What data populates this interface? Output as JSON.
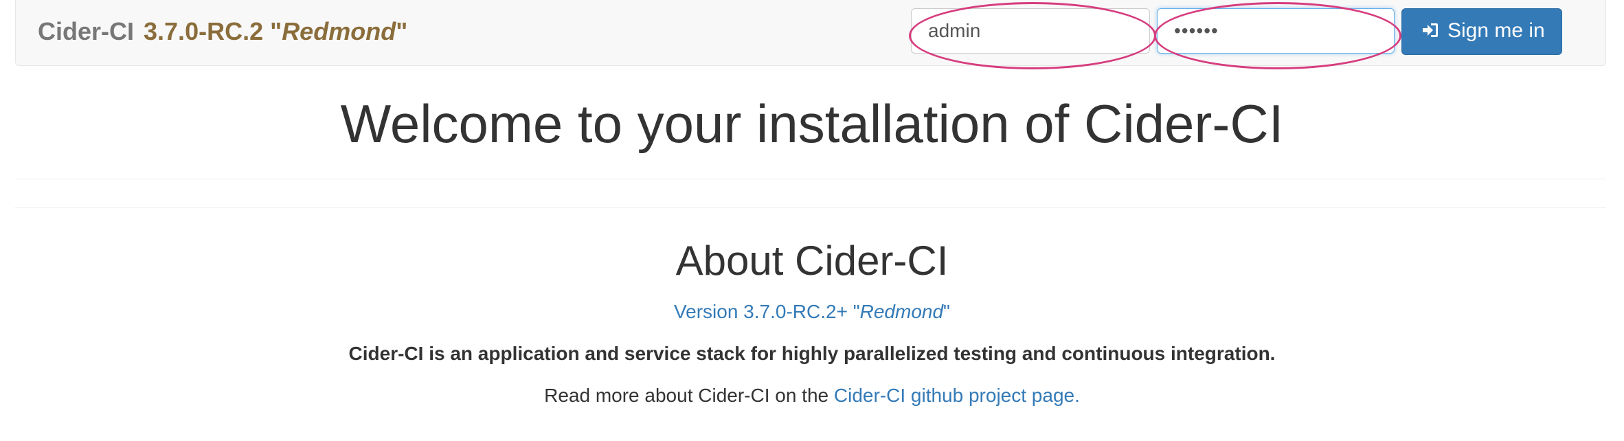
{
  "navbar": {
    "brand_name": "Cider-CI",
    "version_number": "3.7.0-RC.2",
    "quote_open": "\"",
    "codename": "Redmond",
    "quote_close": "\""
  },
  "login": {
    "username_value": "admin",
    "password_value": "••••••",
    "signin_label": "Sign me in",
    "signin_icon": "sign-in-icon"
  },
  "main": {
    "welcome_title": "Welcome to your installation of Cider-CI",
    "about_title": "About Cider-CI",
    "version_prefix": "Version  3.7.0-RC.2+ \"",
    "version_codename": "Redmond",
    "version_suffix": "\"",
    "tagline": "Cider-CI is an application and service stack for highly parallelized testing and continuous integration.",
    "readmore_text": "Read more about Cider-CI on the ",
    "readmore_link": "Cider-CI github project page."
  },
  "colors": {
    "link": "#337ab7",
    "version_brand": "#8a6d3b",
    "annotation": "#d63c7e",
    "primary_button": "#337ab7"
  }
}
